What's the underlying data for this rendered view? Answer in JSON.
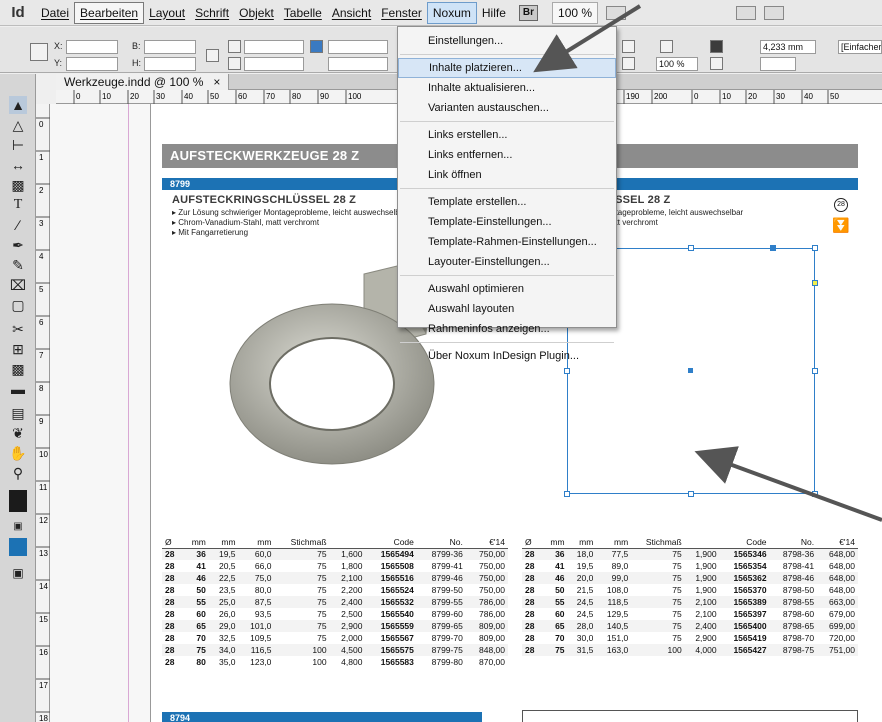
{
  "menubar": {
    "app_logo": "Id",
    "items": [
      {
        "label": "Datei"
      },
      {
        "label": "Bearbeiten"
      },
      {
        "label": "Layout"
      },
      {
        "label": "Schrift"
      },
      {
        "label": "Objekt"
      },
      {
        "label": "Tabelle"
      },
      {
        "label": "Ansicht"
      },
      {
        "label": "Fenster"
      },
      {
        "label": "Noxum"
      },
      {
        "label": "Hilfe"
      }
    ],
    "br_badge": "Br",
    "zoom": "100 %"
  },
  "control_panel": {
    "x_label": "X:",
    "y_label": "Y:",
    "b_label": "B:",
    "h_label": "H:",
    "stroke_value": "4,233 mm",
    "scale_value": "100 %",
    "style_value": "[Einfacher G"
  },
  "document_tab": {
    "title": "Werkzeuge.indd @ 100 %",
    "close": "×"
  },
  "ruler": {
    "h_ticks": [
      "0",
      "10",
      "20",
      "30",
      "40",
      "50",
      "60",
      "70",
      "80",
      "90",
      "100",
      "180",
      "190",
      "200",
      "0",
      "10",
      "20",
      "30",
      "40",
      "50"
    ],
    "v_ticks": [
      "0",
      "1",
      "2",
      "3",
      "4",
      "5",
      "6",
      "7",
      "8",
      "9",
      "10",
      "11",
      "12",
      "13",
      "14",
      "15",
      "16",
      "17",
      "18"
    ]
  },
  "noxum_menu": {
    "items": [
      {
        "label": "Einstellungen..."
      },
      {
        "label": "Inhalte platzieren..."
      },
      {
        "label": "Inhalte aktualisieren..."
      },
      {
        "label": "Varianten austauschen..."
      },
      {
        "label": "Links erstellen..."
      },
      {
        "label": "Links entfernen..."
      },
      {
        "label": "Link öffnen"
      },
      {
        "label": "Template erstellen..."
      },
      {
        "label": "Template-Einstellungen..."
      },
      {
        "label": "Template-Rahmen-Einstellungen..."
      },
      {
        "label": "Layouter-Einstellungen..."
      },
      {
        "label": "Auswahl optimieren"
      },
      {
        "label": "Auswahl layouten"
      },
      {
        "label": "Rahmeninfos anzeigen..."
      },
      {
        "label": "Über Noxum InDesign Plugin..."
      }
    ]
  },
  "document": {
    "section_title": "AUFSTECKWERKZEUGE 28 Z",
    "left_block": {
      "number": "8799",
      "title": "AUFSTECKRINGSCHLÜSSEL 28 Z",
      "features": [
        "Zur Lösung schwieriger Montageprobleme, leicht auswechselbar",
        "Chrom-Vanadium-Stahl, matt verchromt",
        "Mit Fangarretierung"
      ]
    },
    "right_block": {
      "title": "LÜSSEL 28 Z",
      "features": [
        "Montageprobleme, leicht auswechselbar",
        ", matt verchromt"
      ],
      "badge": "28"
    },
    "table_headers": [
      "Ø",
      "mm",
      "mm",
      "mm",
      "Stichmaß",
      "",
      "Code",
      "No.",
      "€'14"
    ],
    "left_rows": [
      [
        "28",
        "36",
        "19,5",
        "60,0",
        "75",
        "1,600",
        "1565494",
        "8799-36",
        "750,00"
      ],
      [
        "28",
        "41",
        "20,5",
        "66,0",
        "75",
        "1,800",
        "1565508",
        "8799-41",
        "750,00"
      ],
      [
        "28",
        "46",
        "22,5",
        "75,0",
        "75",
        "2,100",
        "1565516",
        "8799-46",
        "750,00"
      ],
      [
        "28",
        "50",
        "23,5",
        "80,0",
        "75",
        "2,200",
        "1565524",
        "8799-50",
        "750,00"
      ],
      [
        "28",
        "55",
        "25,0",
        "87,5",
        "75",
        "2,400",
        "1565532",
        "8799-55",
        "786,00"
      ],
      [
        "28",
        "60",
        "26,0",
        "93,5",
        "75",
        "2,500",
        "1565540",
        "8799-60",
        "786,00"
      ],
      [
        "28",
        "65",
        "29,0",
        "101,0",
        "75",
        "2,900",
        "1565559",
        "8799-65",
        "809,00"
      ],
      [
        "28",
        "70",
        "32,5",
        "109,5",
        "75",
        "2,000",
        "1565567",
        "8799-70",
        "809,00"
      ],
      [
        "28",
        "75",
        "34,0",
        "116,5",
        "100",
        "4,500",
        "1565575",
        "8799-75",
        "848,00"
      ],
      [
        "28",
        "80",
        "35,0",
        "123,0",
        "100",
        "4,800",
        "1565583",
        "8799-80",
        "870,00"
      ]
    ],
    "right_rows": [
      [
        "28",
        "36",
        "18,0",
        "77,5",
        "75",
        "1,900",
        "1565346",
        "8798-36",
        "648,00"
      ],
      [
        "28",
        "41",
        "19,5",
        "89,0",
        "75",
        "1,900",
        "1565354",
        "8798-41",
        "648,00"
      ],
      [
        "28",
        "46",
        "20,0",
        "99,0",
        "75",
        "1,900",
        "1565362",
        "8798-46",
        "648,00"
      ],
      [
        "28",
        "50",
        "21,5",
        "108,0",
        "75",
        "1,900",
        "1565370",
        "8798-50",
        "648,00"
      ],
      [
        "28",
        "55",
        "24,5",
        "118,5",
        "75",
        "2,100",
        "1565389",
        "8798-55",
        "663,00"
      ],
      [
        "28",
        "60",
        "24,5",
        "129,5",
        "75",
        "2,100",
        "1565397",
        "8798-60",
        "679,00"
      ],
      [
        "28",
        "65",
        "28,0",
        "140,5",
        "75",
        "2,400",
        "1565400",
        "8798-65",
        "699,00"
      ],
      [
        "28",
        "70",
        "30,0",
        "151,0",
        "75",
        "2,900",
        "1565419",
        "8798-70",
        "720,00"
      ],
      [
        "28",
        "75",
        "31,5",
        "163,0",
        "100",
        "4,000",
        "1565427",
        "8798-75",
        "751,00"
      ]
    ],
    "next_number": "8794"
  }
}
